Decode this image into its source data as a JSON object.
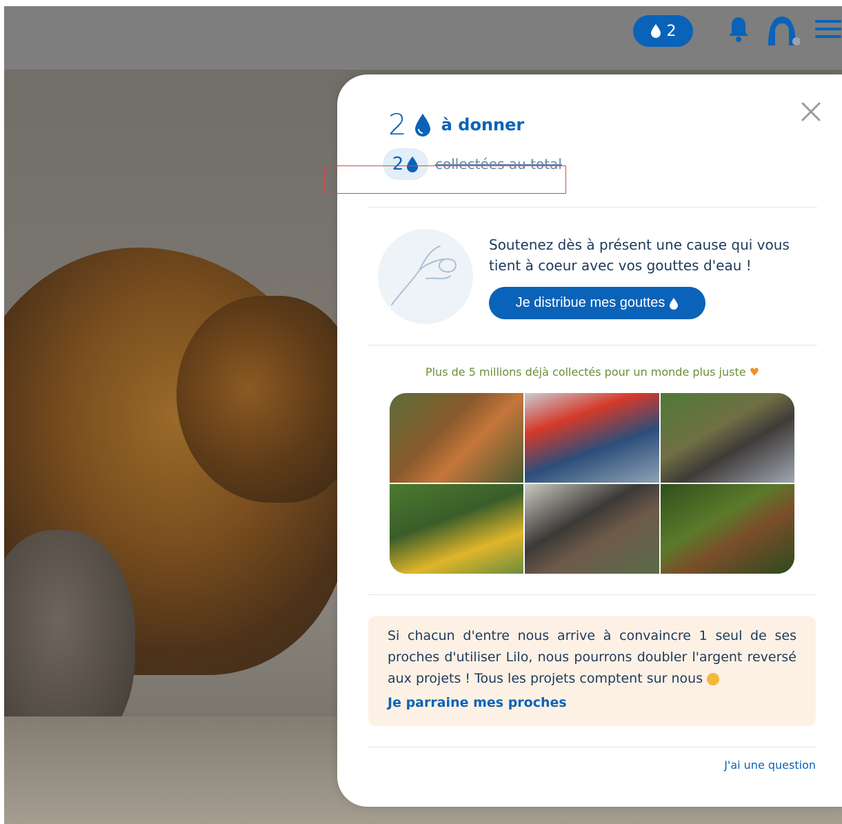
{
  "topbar": {
    "drops_count": "2",
    "icons": [
      "drop-icon",
      "bell-icon",
      "avatar-icon",
      "menu-icon"
    ]
  },
  "panel": {
    "give_count": "2",
    "give_label": "à donner",
    "total_count": "2",
    "total_label": "collectées au total",
    "cause_text": "Soutenez dès à présent une cause qui vous tient à coeur avec vos gouttes d'eau !",
    "distribute_button": "Je distribue mes gouttes",
    "million_text": "Plus de 5 millions déjà collectés pour un monde plus juste",
    "tip_text": "Si chacun d'entre nous arrive à convaincre 1 seul de ses proches d'utiliser Lilo, nous pourrons doubler l'argent reversé aux projets ! Tous les projets comptent sur nous",
    "tip_link": "Je parraine mes proches",
    "question_link": "J'ai une question"
  },
  "colors": {
    "brand_blue": "#0a63b8",
    "green_text": "#6a8e3a",
    "tip_bg": "#fdf1e5",
    "highlight_red": "#d94848"
  }
}
